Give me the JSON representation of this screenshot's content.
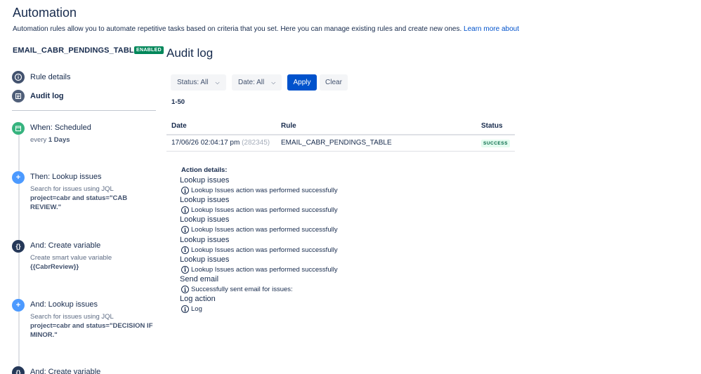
{
  "header": {
    "title": "Automation",
    "description": "Automation rules allow you to automate repetitive tasks based on criteria that you set. Here you can manage existing rules and create new ones.",
    "learn_more": "Learn more about"
  },
  "rule": {
    "name": "EMAIL_CABR_PENDINGS_TABLE",
    "badge": "ENABLED"
  },
  "nav": {
    "items": [
      {
        "label": "Rule details",
        "icon": "info-icon"
      },
      {
        "label": "Audit log",
        "icon": "list-icon"
      }
    ]
  },
  "steps": [
    {
      "title": "When: Scheduled",
      "desc_prefix": "every",
      "desc_bold": "1 Days",
      "icon": "calendar-icon",
      "color": "#36b37e"
    },
    {
      "title": "Then: Lookup issues",
      "desc": "Search for issues using JQL",
      "desc_bold": "project=cabr and status=\"CAB REVIEW.\"",
      "icon": "plus-icon",
      "color": "#4c9aff"
    },
    {
      "title": "And: Create variable",
      "desc": "Create smart value variable",
      "desc_bold": "{{CabrReview}}",
      "icon": "braces-icon",
      "color": "#253858"
    },
    {
      "title": "And: Lookup issues",
      "desc": "Search for issues using JQL",
      "desc_bold": "project=cabr and status=\"DECISION IF MINOR.\"",
      "icon": "plus-icon",
      "color": "#4c9aff"
    },
    {
      "title": "And: Create variable",
      "icon": "braces-icon",
      "color": "#253858"
    }
  ],
  "audit": {
    "title": "Audit log",
    "filters": {
      "status": "Status: All",
      "date": "Date: All",
      "apply": "Apply",
      "clear": "Clear"
    },
    "range": "1-50",
    "columns": [
      "Date",
      "Rule",
      "Status"
    ],
    "rows": [
      {
        "date": "17/06/26 02:04:17 pm",
        "id": "(282345)",
        "rule": "EMAIL_CABR_PENDINGS_TABLE",
        "status": "SUCCESS"
      }
    ],
    "details_title": "Action details:",
    "actions": [
      {
        "name": "Lookup issues",
        "message": "Lookup Issues action was performed successfully"
      },
      {
        "name": "Lookup issues",
        "message": "Lookup Issues action was performed successfully"
      },
      {
        "name": "Lookup issues",
        "message": "Lookup Issues action was performed successfully"
      },
      {
        "name": "Lookup issues",
        "message": "Lookup Issues action was performed successfully"
      },
      {
        "name": "Lookup issues",
        "message": "Lookup Issues action was performed successfully"
      },
      {
        "name": "Send email",
        "message": "Successfully sent email for issues:"
      },
      {
        "name": "Log action",
        "message": "Log"
      }
    ]
  },
  "colors": {
    "primary": "#0052cc",
    "success": "#00875a",
    "text": "#172b4d"
  }
}
